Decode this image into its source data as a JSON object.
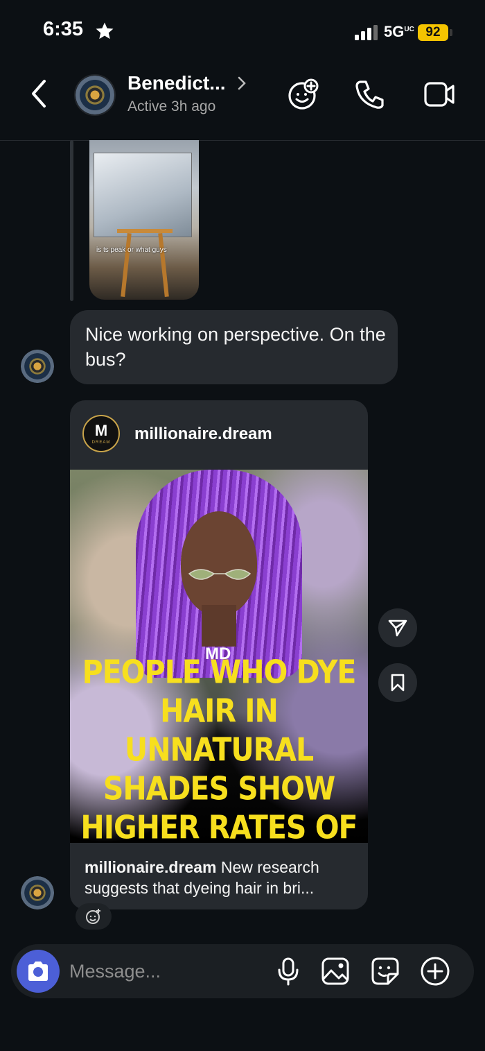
{
  "status_bar": {
    "time": "6:35",
    "network": "5G",
    "network_sup": "UC",
    "battery": "92"
  },
  "header": {
    "name": "Benedict...",
    "status": "Active 3h ago"
  },
  "story_reply": {
    "caption": "is ts peak or what guys"
  },
  "messages": [
    {
      "text": "Nice working on perspective. On the bus?"
    }
  ],
  "shared_post": {
    "username": "millionaire.dream",
    "logo_letter": "M",
    "logo_sub": "DREAM",
    "watermark": "MD",
    "headline": "PEOPLE WHO DYE HAIR IN UNNATURAL SHADES SHOW HIGHER RATES OF MENTAL INSTABILITY",
    "caption_user": "millionaire.dream",
    "caption_text": " New research suggests that dyeing hair in bri..."
  },
  "composer": {
    "placeholder": "Message..."
  },
  "icons": [
    "back-icon",
    "chevron-right-icon",
    "games-icon",
    "phone-icon",
    "video-icon",
    "share-icon",
    "bookmark-icon",
    "add-reaction-icon",
    "camera-icon",
    "microphone-icon",
    "gallery-icon",
    "sticker-icon",
    "plus-icon"
  ],
  "colors": {
    "background": "#0c1014",
    "bubble": "#262a2f",
    "camera_button": "#4c5fd7",
    "headline": "#f7df1e",
    "battery": "#f5c400"
  }
}
